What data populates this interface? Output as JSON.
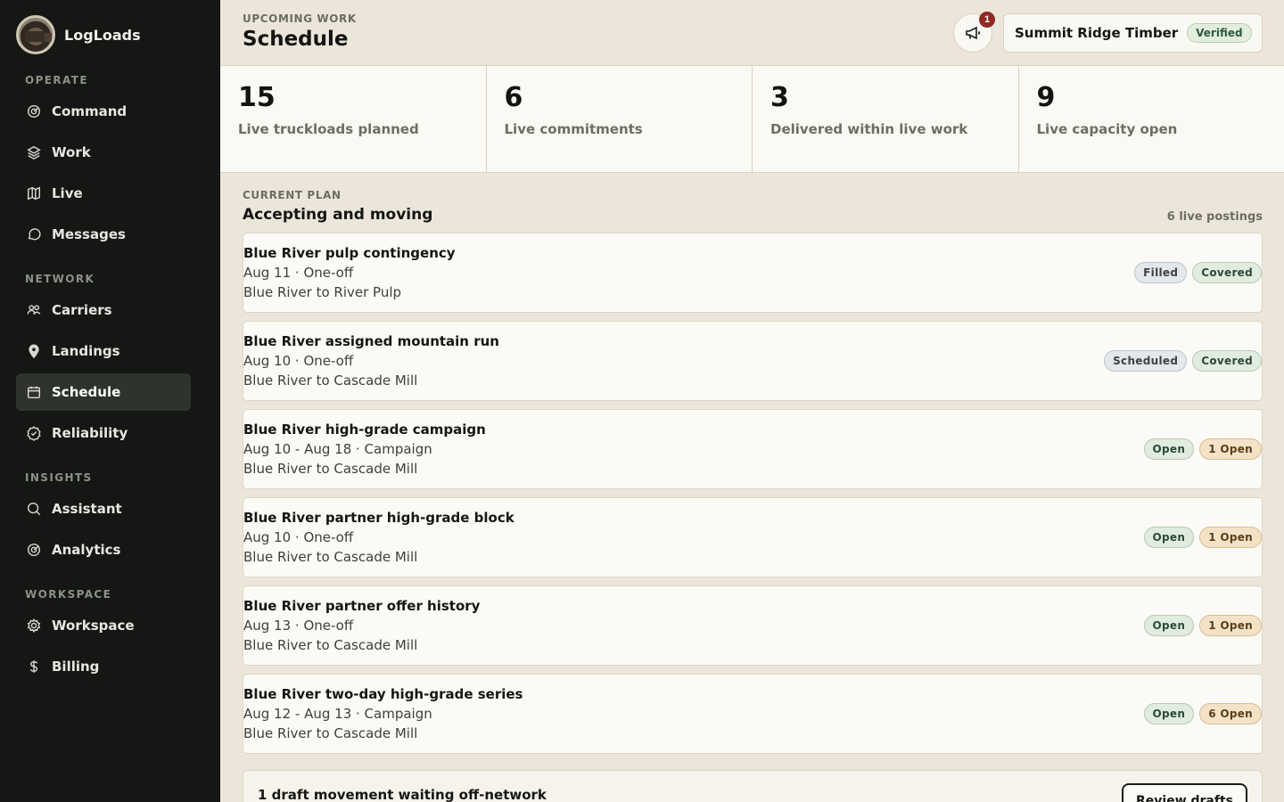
{
  "brand": {
    "name": "LogLoads"
  },
  "sidebar": {
    "sections": [
      {
        "label": "OPERATE",
        "items": [
          {
            "label": "Command",
            "icon": "radar-icon"
          },
          {
            "label": "Work",
            "icon": "layers-icon"
          },
          {
            "label": "Live",
            "icon": "map-icon"
          },
          {
            "label": "Messages",
            "icon": "chat-icon"
          }
        ]
      },
      {
        "label": "NETWORK",
        "items": [
          {
            "label": "Carriers",
            "icon": "users-icon"
          },
          {
            "label": "Landings",
            "icon": "pin-icon"
          },
          {
            "label": "Schedule",
            "icon": "calendar-icon"
          },
          {
            "label": "Reliability",
            "icon": "badge-check-icon"
          }
        ]
      },
      {
        "label": "INSIGHTS",
        "items": [
          {
            "label": "Assistant",
            "icon": "search-icon"
          },
          {
            "label": "Analytics",
            "icon": "radar-icon"
          }
        ]
      },
      {
        "label": "WORKSPACE",
        "items": [
          {
            "label": "Workspace",
            "icon": "gear-icon"
          },
          {
            "label": "Billing",
            "icon": "dollar-icon"
          }
        ]
      }
    ],
    "active": "Schedule"
  },
  "header": {
    "eyebrow": "UPCOMING WORK",
    "title": "Schedule",
    "notifications": "1",
    "org": "Summit Ridge Timber",
    "org_status": "Verified"
  },
  "stats": [
    {
      "value": "15",
      "label": "Live truckloads planned"
    },
    {
      "value": "6",
      "label": "Live commitments"
    },
    {
      "value": "3",
      "label": "Delivered within live work"
    },
    {
      "value": "9",
      "label": "Live capacity open"
    }
  ],
  "plan": {
    "eyebrow": "CURRENT PLAN",
    "title": "Accepting and moving",
    "count": "6 live postings",
    "items": [
      {
        "title": "Blue River pulp contingency",
        "date": "Aug 11 · One-off",
        "route": "Blue River to River Pulp",
        "badges": [
          {
            "text": "Filled",
            "tone": "grey"
          },
          {
            "text": "Covered",
            "tone": "green"
          }
        ]
      },
      {
        "title": "Blue River assigned mountain run",
        "date": "Aug 10 · One-off",
        "route": "Blue River to Cascade Mill",
        "badges": [
          {
            "text": "Scheduled",
            "tone": "grey"
          },
          {
            "text": "Covered",
            "tone": "green"
          }
        ]
      },
      {
        "title": "Blue River high-grade campaign",
        "date": "Aug 10 - Aug 18 · Campaign",
        "route": "Blue River to Cascade Mill",
        "badges": [
          {
            "text": "Open",
            "tone": "green"
          },
          {
            "text": "1 Open",
            "tone": "tan"
          }
        ]
      },
      {
        "title": "Blue River partner high-grade block",
        "date": "Aug 10 · One-off",
        "route": "Blue River to Cascade Mill",
        "badges": [
          {
            "text": "Open",
            "tone": "green"
          },
          {
            "text": "1 Open",
            "tone": "tan"
          }
        ]
      },
      {
        "title": "Blue River partner offer history",
        "date": "Aug 13 · One-off",
        "route": "Blue River to Cascade Mill",
        "badges": [
          {
            "text": "Open",
            "tone": "green"
          },
          {
            "text": "1 Open",
            "tone": "tan"
          }
        ]
      },
      {
        "title": "Blue River two-day high-grade series",
        "date": "Aug 12 - Aug 13 · Campaign",
        "route": "Blue River to Cascade Mill",
        "badges": [
          {
            "text": "Open",
            "tone": "green"
          },
          {
            "text": "6 Open",
            "tone": "tan"
          }
        ]
      }
    ]
  },
  "draft": {
    "text": "1 draft movement waiting off-network",
    "button": "Review drafts"
  }
}
